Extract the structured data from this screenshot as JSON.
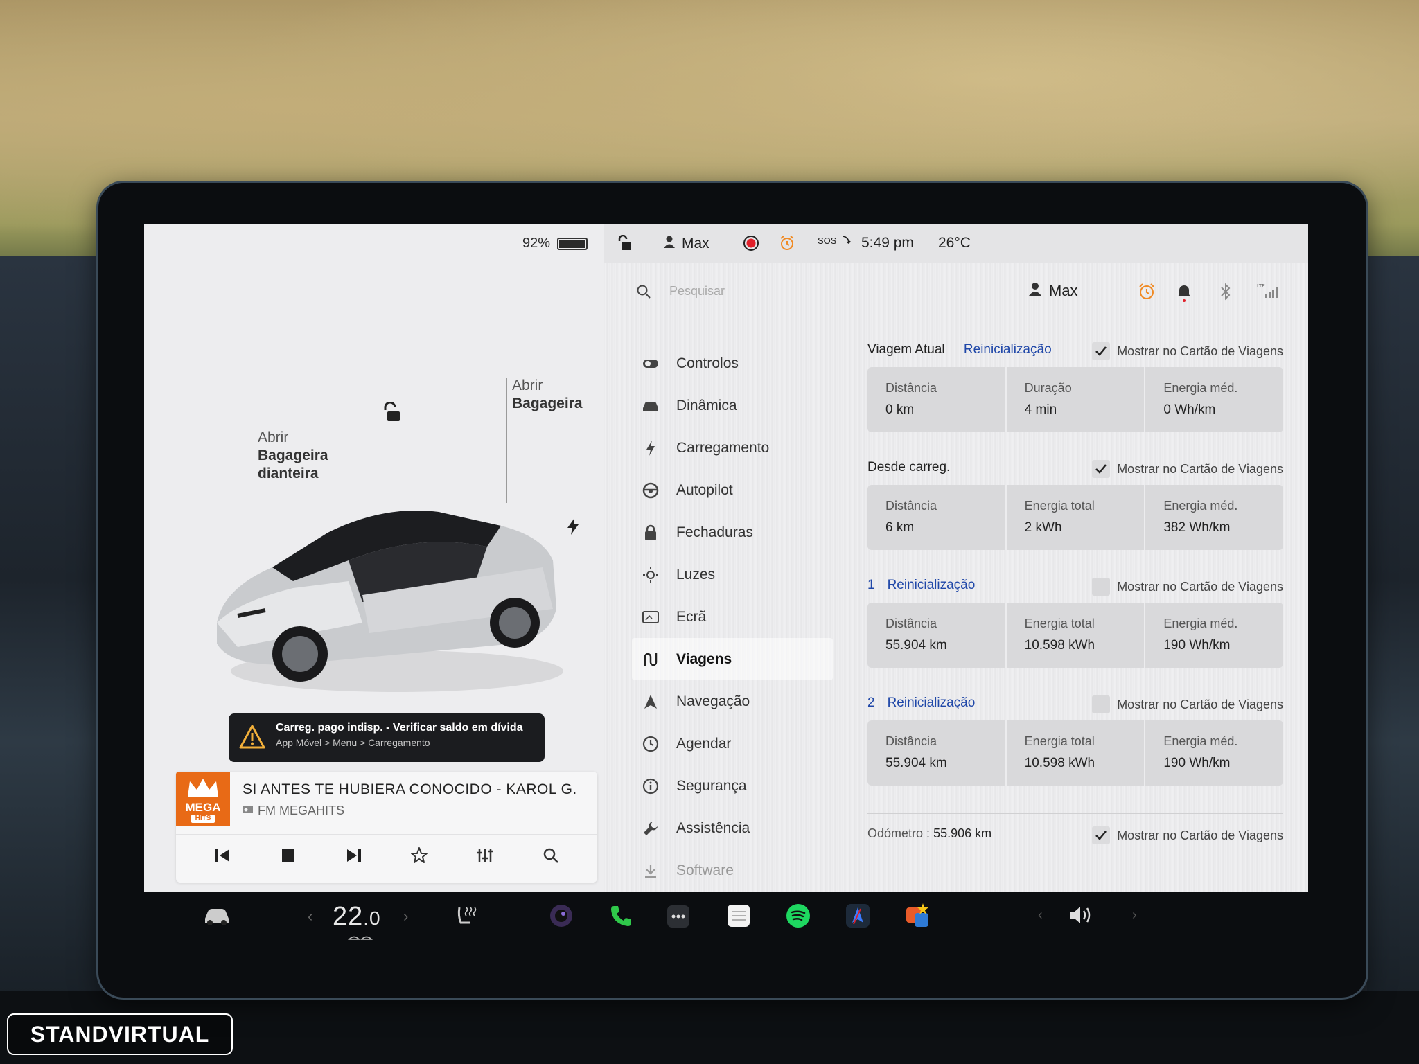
{
  "left": {
    "battery_percent_text": "92%",
    "battery_level": 0.92,
    "callouts": {
      "frunk_line1": "Abrir",
      "frunk_line2": "Bagageira",
      "frunk_line3": "dianteira",
      "trunk_line1": "Abrir",
      "trunk_line2": "Bagageira"
    },
    "alert": {
      "title": "Carreg. pago indisp. - Verificar saldo em dívida",
      "subtitle": "App Móvel > Menu > Carregamento"
    },
    "media": {
      "logo_word": "MEGA",
      "logo_sub": "HITS",
      "song": "SI ANTES TE HUBIERA CONOCIDO - KAROL G.",
      "station": "FM MEGAHITS"
    }
  },
  "topbar": {
    "user": "Max",
    "sos": "SOS",
    "time": "5:49 pm",
    "temperature": "26°C"
  },
  "search": {
    "placeholder": "Pesquisar",
    "user": "Max"
  },
  "menu": [
    {
      "label": "Controlos",
      "icon": "toggle-icon"
    },
    {
      "label": "Dinâmica",
      "icon": "car-icon"
    },
    {
      "label": "Carregamento",
      "icon": "bolt-icon"
    },
    {
      "label": "Autopilot",
      "icon": "steering-wheel-icon"
    },
    {
      "label": "Fechaduras",
      "icon": "lock-icon"
    },
    {
      "label": "Luzes",
      "icon": "light-icon"
    },
    {
      "label": "Ecrã",
      "icon": "display-icon"
    },
    {
      "label": "Viagens",
      "icon": "trips-icon"
    },
    {
      "label": "Navegação",
      "icon": "navigation-icon"
    },
    {
      "label": "Agendar",
      "icon": "schedule-icon"
    },
    {
      "label": "Segurança",
      "icon": "info-icon"
    },
    {
      "label": "Assistência",
      "icon": "wrench-icon"
    },
    {
      "label": "Software",
      "icon": "download-icon"
    }
  ],
  "trips": {
    "show_label": "Mostrar no Cartão de Viagens",
    "reset_label": "Reinicialização",
    "current": {
      "title": "Viagem Atual",
      "show_checked": true,
      "stats": [
        {
          "label": "Distância",
          "value": "0 km"
        },
        {
          "label": "Duração",
          "value": "4 min"
        },
        {
          "label": "Energia méd.",
          "value": "0 Wh/km"
        }
      ]
    },
    "since_charge": {
      "title": "Desde carreg.",
      "show_checked": true,
      "stats": [
        {
          "label": "Distância",
          "value": "6 km"
        },
        {
          "label": "Energia total",
          "value": "2 kWh"
        },
        {
          "label": "Energia méd.",
          "value": "382 Wh/km"
        }
      ]
    },
    "trip1": {
      "number": "1",
      "show_checked": false,
      "stats": [
        {
          "label": "Distância",
          "value": "55.904 km"
        },
        {
          "label": "Energia total",
          "value": "10.598 kWh"
        },
        {
          "label": "Energia méd.",
          "value": "190 Wh/km"
        }
      ]
    },
    "trip2": {
      "number": "2",
      "show_checked": false,
      "stats": [
        {
          "label": "Distância",
          "value": "55.904 km"
        },
        {
          "label": "Energia total",
          "value": "10.598 kWh"
        },
        {
          "label": "Energia méd.",
          "value": "190 Wh/km"
        }
      ]
    },
    "odometer": {
      "label": "Odómetro :",
      "value": "55.906 km",
      "show_checked": true
    }
  },
  "dock": {
    "temperature_int": "22",
    "temperature_dec": ".0"
  },
  "watermark": "STANDVIRTUAL",
  "colors": {
    "accent_blue": "#1f47a8",
    "record_red": "#e0202a",
    "alarm_orange": "#f08a24",
    "phone_green": "#2fc84a",
    "spotify_green": "#1ed760"
  }
}
